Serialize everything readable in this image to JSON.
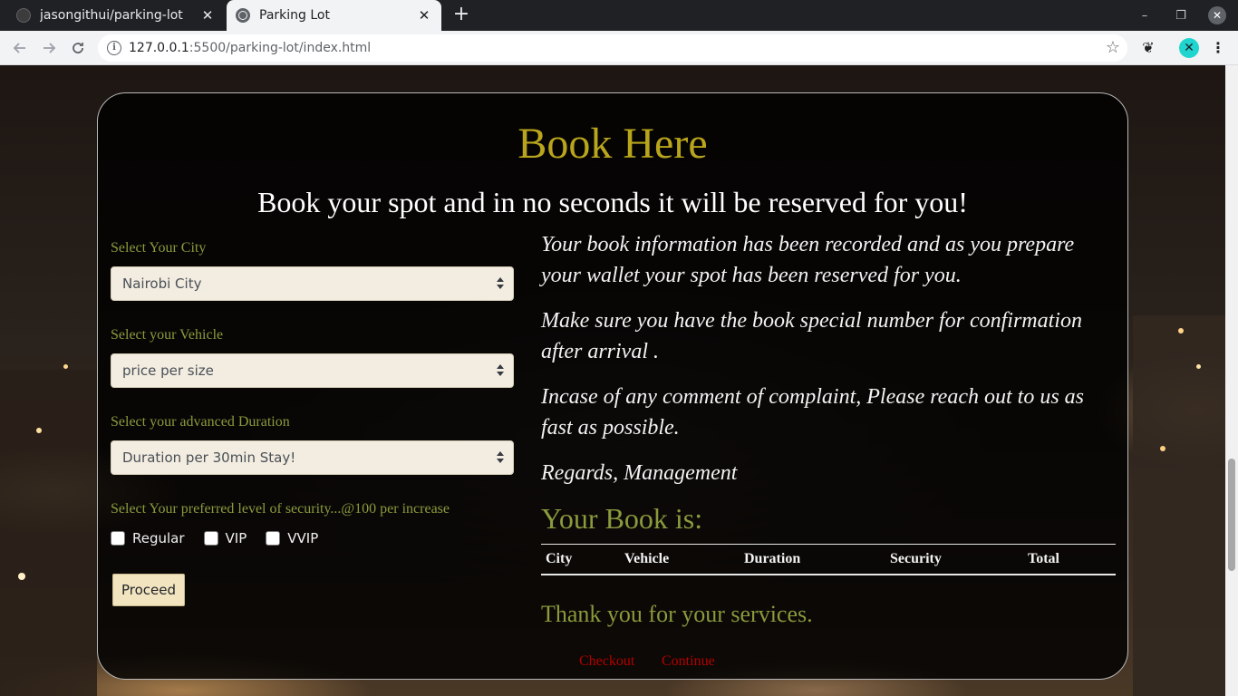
{
  "browser": {
    "tabs": [
      {
        "title": "jasongithui/parking-lot",
        "active": false
      },
      {
        "title": "Parking Lot",
        "active": true
      }
    ],
    "new_tab_icon": "+",
    "url_host": "127.0.0.1",
    "url_rest": ":5500/parking-lot/index.html",
    "controls": {
      "minimize": "–",
      "restore": "❐",
      "close": "✕"
    }
  },
  "page": {
    "title": "Book Here",
    "subtitle": "Book your spot and in no seconds it will be reserved for you!",
    "form": {
      "city_label": "Select Your City",
      "city_value": "Nairobi City",
      "vehicle_label": "Select your Vehicle",
      "vehicle_value": "price per size",
      "duration_label": "Select your advanced Duration",
      "duration_value": "Duration per 30min Stay!",
      "security_label": "Select Your preferred level of security...@100 per increase",
      "security_options": [
        "Regular",
        "VIP",
        "VVIP"
      ],
      "proceed_label": "Proceed"
    },
    "info": {
      "p1": "Your book information has been recorded and as you prepare your wallet your spot has been reserved for you.",
      "p2": "Make sure you have the book special number for confirmation after arrival .",
      "p3": "Incase of any comment of complaint, Please reach out to us as fast as possible.",
      "p4": "Regards, Management"
    },
    "summary": {
      "heading": "Your Book is:",
      "columns": [
        "City",
        "Vehicle",
        "Duration",
        "Security",
        "Total"
      ]
    },
    "thanks": "Thank you for your services.",
    "links": {
      "checkout": "Checkout",
      "continue": "Continue"
    }
  },
  "colors": {
    "title_gold": "#b9a51c",
    "label_olive": "#8a9a3c",
    "link_red": "#b30000",
    "select_bg": "#f3ece0"
  }
}
